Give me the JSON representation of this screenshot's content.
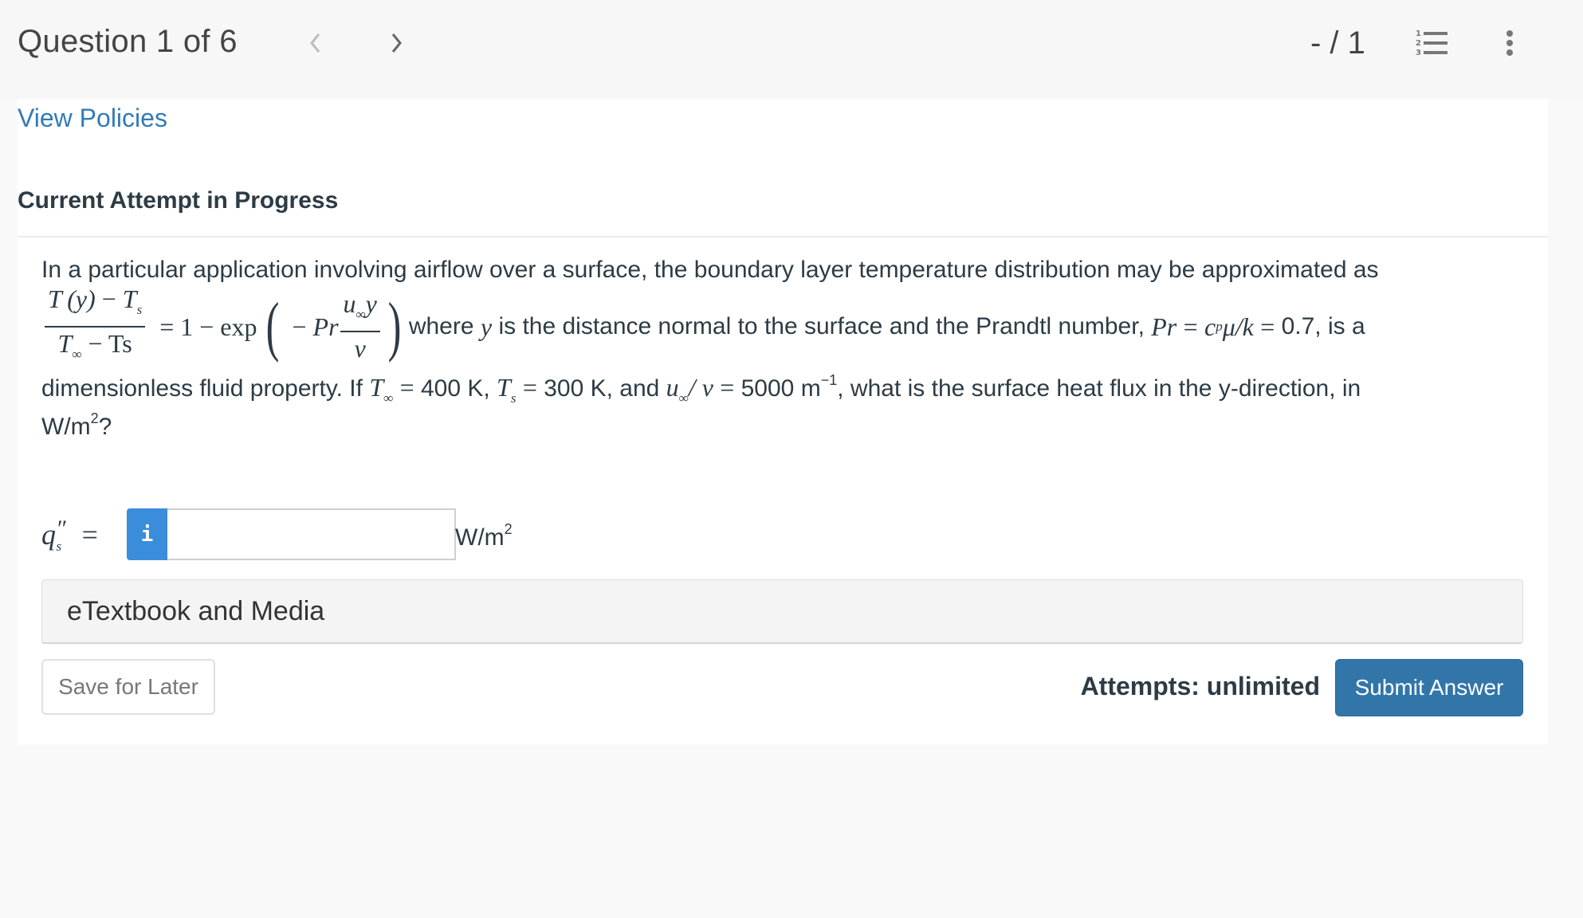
{
  "header": {
    "question_counter": "Question 1 of 6",
    "prev_icon": "chevron-left-icon",
    "next_icon": "chevron-right-icon",
    "score": "- / 1",
    "list_icon": "numbered-list-icon",
    "menu_icon": "kebab-menu-icon"
  },
  "panel": {
    "view_policies": "View Policies",
    "attempt_title": "Current Attempt in Progress"
  },
  "question": {
    "line1": "In a particular application involving airflow over a surface, the boundary layer temperature distribution may be approximated as",
    "eq": {
      "num_T": "T",
      "num_y": "(y)",
      "minus": "−",
      "Ts_T": "T",
      "Ts_sub": "s",
      "den_T": "T",
      "den_inf": "∞",
      "den_Ts": "Ts",
      "equals_one_minus_exp": "= 1 − exp",
      "neg": "−",
      "Pr": "Pr",
      "frac_u": "u",
      "frac_inf": "∞",
      "frac_y": "y",
      "frac_nu": "ν"
    },
    "eq_tail_1": "where",
    "eq_tail_y": "y",
    "eq_tail_2": "is the distance normal to the surface and the Prandtl number,",
    "pr_expr_Pr": "Pr",
    "pr_expr_eq": "=",
    "pr_expr_c": "c",
    "pr_expr_p": "p",
    "pr_expr_rest": "μ/k",
    "pr_expr_eq2": "=",
    "pr_value": "0.7, is a",
    "line3_a": "dimensionless fluid property. If",
    "Tinf_T": "T",
    "Tinf_sub": "∞",
    "eq_sign": "=",
    "Tinf_val": "400 K,",
    "Ts_T": "T",
    "Ts_sub": "s",
    "Ts_val": "300 K, and",
    "u_sym": "u",
    "u_sub": "∞",
    "u_over_nu": "/ ν",
    "ratio_val": "5000 m",
    "ratio_exp": "−1",
    "line3_b": ", what is the surface heat flux in the y-direction, in",
    "line4_unit": "W/m",
    "line4_exp": "2",
    "line4_q": "?"
  },
  "answer": {
    "label_q": "q",
    "label_prime": "″",
    "label_sub": "s",
    "label_eq": "=",
    "info_glyph": "i",
    "input_value": "",
    "input_placeholder": "",
    "unit": "W/m",
    "unit_exp": "2"
  },
  "etextbook": {
    "label": "eTextbook and Media"
  },
  "footer": {
    "save_label": "Save for Later",
    "attempts": "Attempts: unlimited",
    "submit_label": "Submit Answer"
  },
  "colors": {
    "link": "#337ab7",
    "submit": "#3276a9",
    "info": "#3a8ddb",
    "text": "#2d3b45"
  }
}
